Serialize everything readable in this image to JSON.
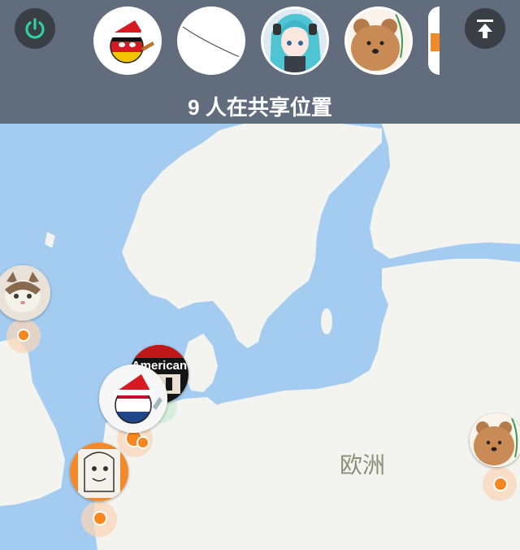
{
  "header": {
    "power_icon": "power-icon",
    "collapse_icon": "collapse-up-icon",
    "share_count_text": "9 人在共享位置",
    "avatars": [
      {
        "name": "germany-ball-avatar",
        "icon": "germany-countryball-icon"
      },
      {
        "name": "blank-sketch-avatar",
        "icon": "sketch-line-icon"
      },
      {
        "name": "anime-girl-avatar",
        "icon": "anime-girl-icon"
      },
      {
        "name": "bear-avatar",
        "icon": "bear-icon"
      },
      {
        "name": "partial-avatar",
        "icon": "partial-avatar-icon"
      }
    ]
  },
  "map": {
    "region_label": "欧洲",
    "colors": {
      "sea": "#a3ccf0",
      "land": "#f3f3ef",
      "accent": "#f7861e",
      "halo": "#fad7b9"
    },
    "pins": [
      {
        "name": "cat-pin",
        "icon": "cat-icon"
      },
      {
        "name": "american-pin",
        "icon": "american-badge-icon",
        "label": "American"
      },
      {
        "name": "netherlands-ball-pin",
        "icon": "netherlands-countryball-icon"
      },
      {
        "name": "sketch-pin",
        "icon": "sketch-character-icon"
      },
      {
        "name": "bear-pin",
        "icon": "bear-icon"
      }
    ]
  }
}
